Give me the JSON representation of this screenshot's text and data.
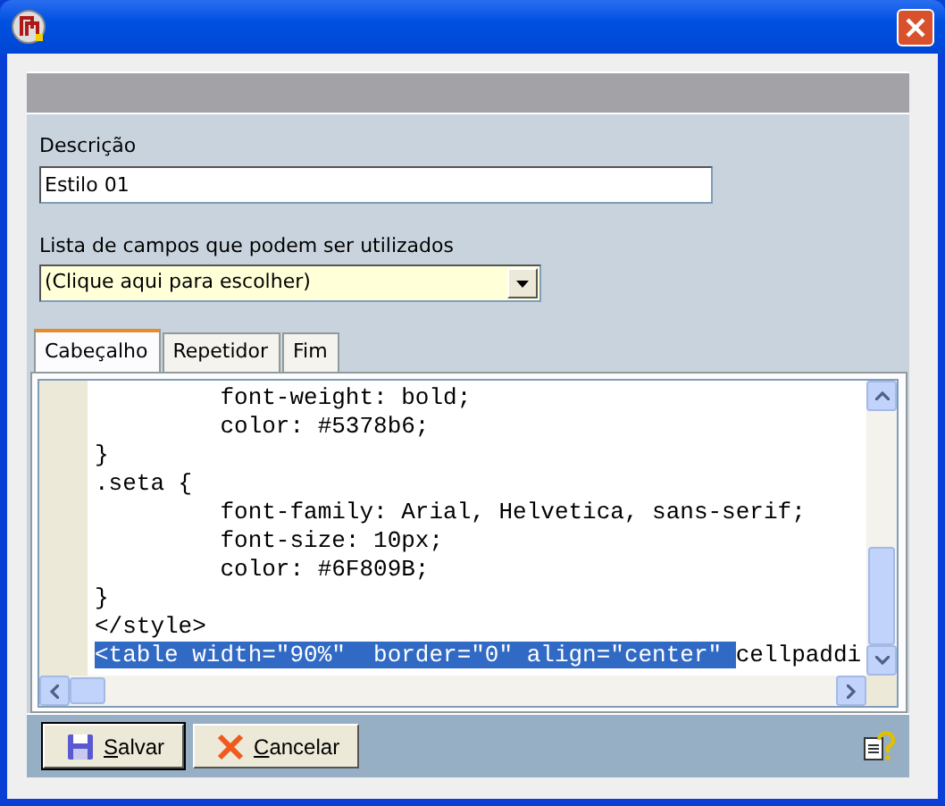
{
  "description": {
    "label": "Descrição",
    "value": "Estilo 01"
  },
  "field_list": {
    "label": "Lista de campos que podem ser utilizados",
    "value": "(Clique aqui para escolher)"
  },
  "tabs": [
    {
      "label": "Cabeçalho",
      "selected": true
    },
    {
      "label": "Repetidor",
      "selected": false
    },
    {
      "label": "Fim",
      "selected": false
    }
  ],
  "editor": {
    "lines": [
      [
        {
          "text": "         font-weight: bold;",
          "selected": false
        }
      ],
      [
        {
          "text": "         color: #5378b6;",
          "selected": false
        }
      ],
      [
        {
          "text": "}",
          "selected": false
        }
      ],
      [
        {
          "text": ".seta {",
          "selected": false
        }
      ],
      [
        {
          "text": "         font-family: Arial, Helvetica, sans-serif;",
          "selected": false
        }
      ],
      [
        {
          "text": "         font-size: 10px;",
          "selected": false
        }
      ],
      [
        {
          "text": "         color: #6F809B;",
          "selected": false
        }
      ],
      [
        {
          "text": "}",
          "selected": false
        }
      ],
      [
        {
          "text": "</style>",
          "selected": false
        }
      ],
      [
        {
          "text": "<table width=\"90%\"  border=\"0\" align=\"center\" ",
          "selected": true
        },
        {
          "text": "cellpaddi",
          "selected": false
        }
      ]
    ]
  },
  "buttons": [
    {
      "kind": "save",
      "label": "Salvar",
      "default": true
    },
    {
      "kind": "cancel",
      "label": "Cancelar",
      "default": false
    }
  ]
}
